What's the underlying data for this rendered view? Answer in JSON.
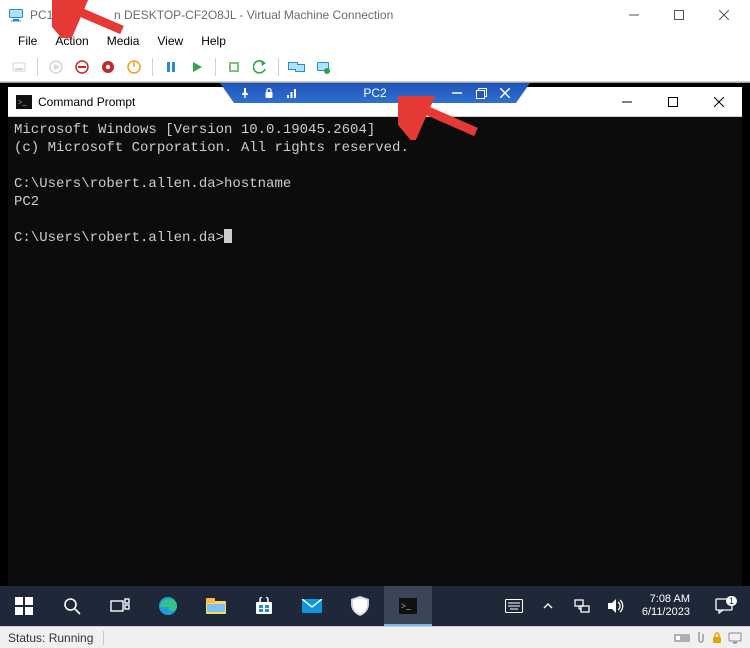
{
  "vm_window": {
    "title_prefix": "PC1",
    "title_suffix": "n DESKTOP-CF2O8JL - Virtual Machine Connection",
    "menus": [
      "File",
      "Action",
      "Media",
      "View",
      "Help"
    ]
  },
  "conn_bar": {
    "label": "PC2"
  },
  "cmd": {
    "title": "Command Prompt",
    "line1": "Microsoft Windows [Version 10.0.19045.2604]",
    "line2": "(c) Microsoft Corporation. All rights reserved.",
    "blank": "",
    "prompt1": "C:\\Users\\robert.allen.da>hostname",
    "output1": "PC2",
    "prompt2": "C:\\Users\\robert.allen.da>"
  },
  "taskbar": {
    "icons": [
      "start",
      "search",
      "taskview",
      "edge",
      "explorer",
      "store",
      "mail",
      "security",
      "cmd"
    ],
    "time": "7:08 AM",
    "date": "6/11/2023"
  },
  "status": {
    "text": "Status: Running"
  }
}
